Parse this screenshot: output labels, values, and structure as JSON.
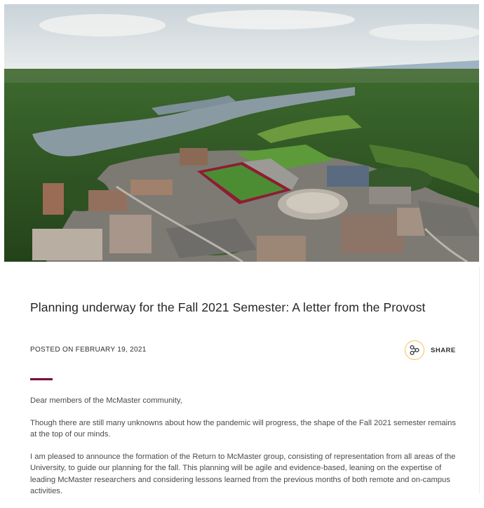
{
  "hero": {
    "icon": "campus-aerial-photo"
  },
  "article": {
    "title": "Planning underway for the Fall 2021 Semester: A letter from the Provost",
    "posted": "POSTED ON FEBRUARY 19, 2021",
    "share_label": "SHARE",
    "share_icon": "share-nodes-icon",
    "accent_color": "#7a003c",
    "share_ring_color": "#fdbf57",
    "paragraphs": [
      "Dear members of the McMaster community,",
      "Though there are still many unknowns about how the pandemic will progress, the shape of the Fall 2021 semester remains at the top of our minds.",
      "I am pleased to announce the formation of the Return to McMaster group, consisting of representation from all areas of the University, to guide our planning for the fall. This planning will be agile and evidence-based, leaning on the expertise of leading McMaster researchers and considering lessons learned from the previous months of both remote and on-campus activities."
    ]
  }
}
